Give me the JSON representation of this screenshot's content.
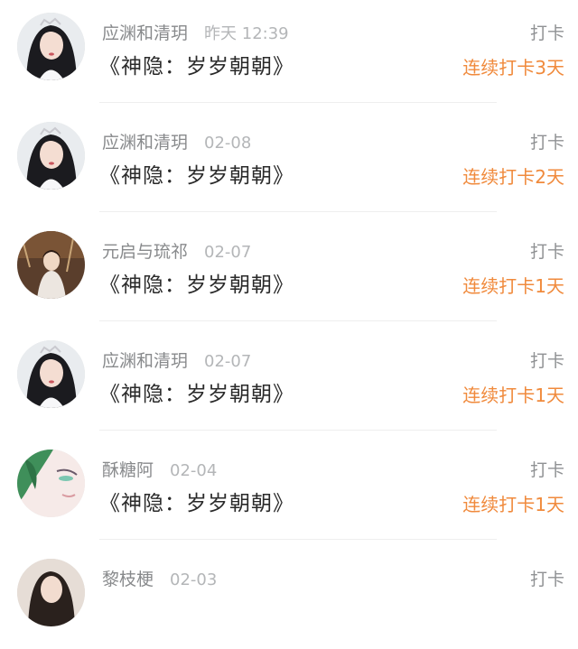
{
  "feed": {
    "items": [
      {
        "user": "应渊和清玥",
        "time": "昨天 12:39",
        "title": "《神隐：岁岁朝朝》",
        "action": "打卡",
        "streak": "连续打卡3天",
        "avatar": "portrait-dark-hair"
      },
      {
        "user": "应渊和清玥",
        "time": "02-08",
        "title": "《神隐：岁岁朝朝》",
        "action": "打卡",
        "streak": "连续打卡2天",
        "avatar": "portrait-dark-hair"
      },
      {
        "user": "元启与琉祁",
        "time": "02-07",
        "title": "《神隐：岁岁朝朝》",
        "action": "打卡",
        "streak": "连续打卡1天",
        "avatar": "portrait-brown-scene"
      },
      {
        "user": "应渊和清玥",
        "time": "02-07",
        "title": "《神隐：岁岁朝朝》",
        "action": "打卡",
        "streak": "连续打卡1天",
        "avatar": "portrait-dark-hair"
      },
      {
        "user": "酥糖阿",
        "time": "02-04",
        "title": "《神隐：岁岁朝朝》",
        "action": "打卡",
        "streak": "连续打卡1天",
        "avatar": "anime-green-hair"
      },
      {
        "user": "黎枝梗",
        "time": "02-03",
        "title": "",
        "action": "打卡",
        "streak": "",
        "avatar": "portrait-dark-hair"
      }
    ]
  },
  "colors": {
    "streak": "#f08a3c",
    "username": "#888a8c",
    "time": "#b4b6b8",
    "title": "#2a2a2a"
  }
}
